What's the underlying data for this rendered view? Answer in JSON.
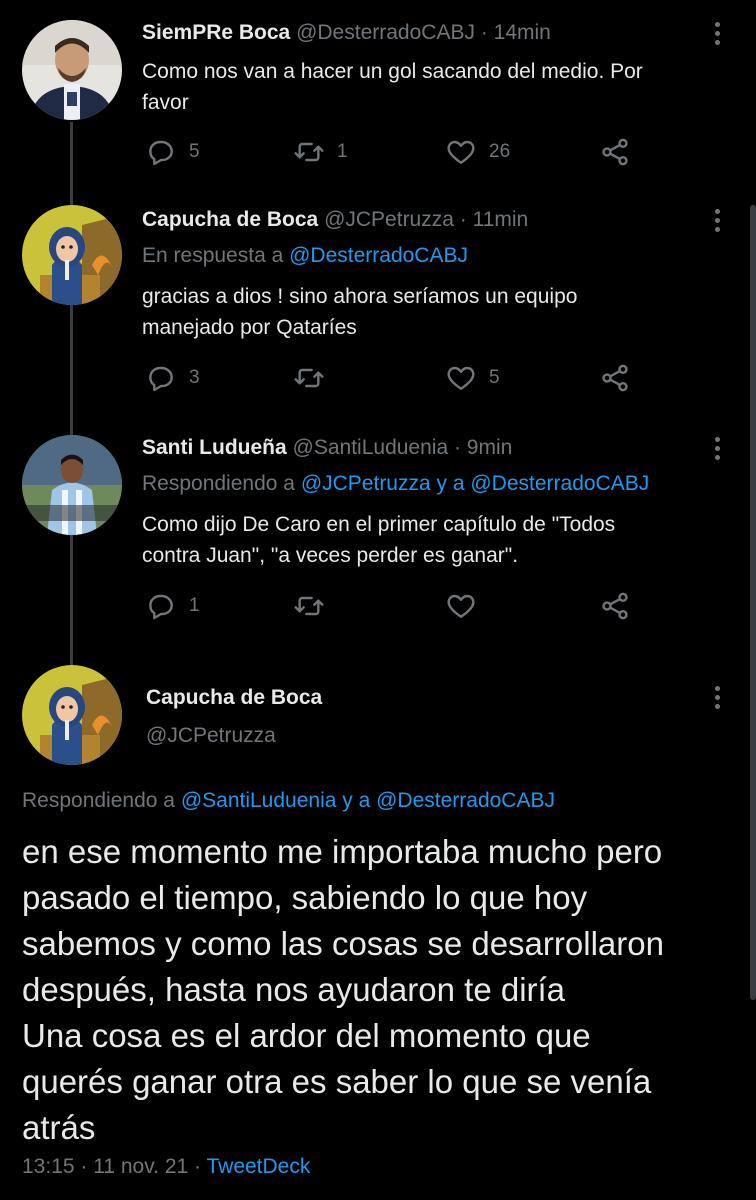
{
  "tweets": [
    {
      "name": "SiemPRe Boca",
      "handle": "@DesterradoCABJ",
      "time": "· 14min",
      "text_lines": [
        "Como nos van a hacer un gol sacando del medio. Por",
        "favor"
      ],
      "replies": "5",
      "retweets": "1",
      "likes": "26"
    },
    {
      "name": "Capucha de Boca",
      "handle": "@JCPetruzza",
      "time": "· 11min",
      "reply_prefix": "En respuesta a",
      "reply_mentions": "@DesterradoCABJ",
      "text_lines": [
        "gracias a dios ! sino ahora seríamos un equipo",
        "manejado por Qataríes"
      ],
      "replies": "3",
      "retweets": "",
      "likes": "5"
    },
    {
      "name": "Santi Ludueña",
      "handle": "@SantiLuduenia",
      "time": "· 9min",
      "reply_prefix": "Respondiendo a",
      "reply_mentions": "@JCPetruzza y a @DesterradoCABJ",
      "text_lines": [
        "Como dijo De Caro en el primer capítulo de \"Todos",
        "contra Juan\", \"a veces perder es ganar\"."
      ],
      "replies": "1",
      "retweets": "",
      "likes": ""
    }
  ],
  "main": {
    "name": "Capucha de Boca",
    "handle": "@JCPetruzza",
    "reply_prefix": "Respondiendo a",
    "reply_mentions": "@SantiLuduenia y a @DesterradoCABJ",
    "text_lines": [
      "en ese momento me importaba mucho pero",
      "pasado el tiempo, sabiendo lo que hoy",
      "sabemos y como las cosas se desarrollaron",
      "después, hasta nos ayudaron te diría",
      "Una cosa es el ardor del momento que",
      "querés ganar otra es saber lo que se venía",
      "atrás"
    ],
    "timestamp": "13:15 · 11 nov. 21 ·",
    "source": "TweetDeck"
  },
  "icons": {
    "reply": "reply-icon",
    "retweet": "retweet-icon",
    "like": "heart-icon",
    "share": "share-icon",
    "more": "more-icon"
  },
  "colors": {
    "background": "#000000",
    "text": "#e7e9ea",
    "muted": "#71767b",
    "link": "#1d9bf0"
  }
}
